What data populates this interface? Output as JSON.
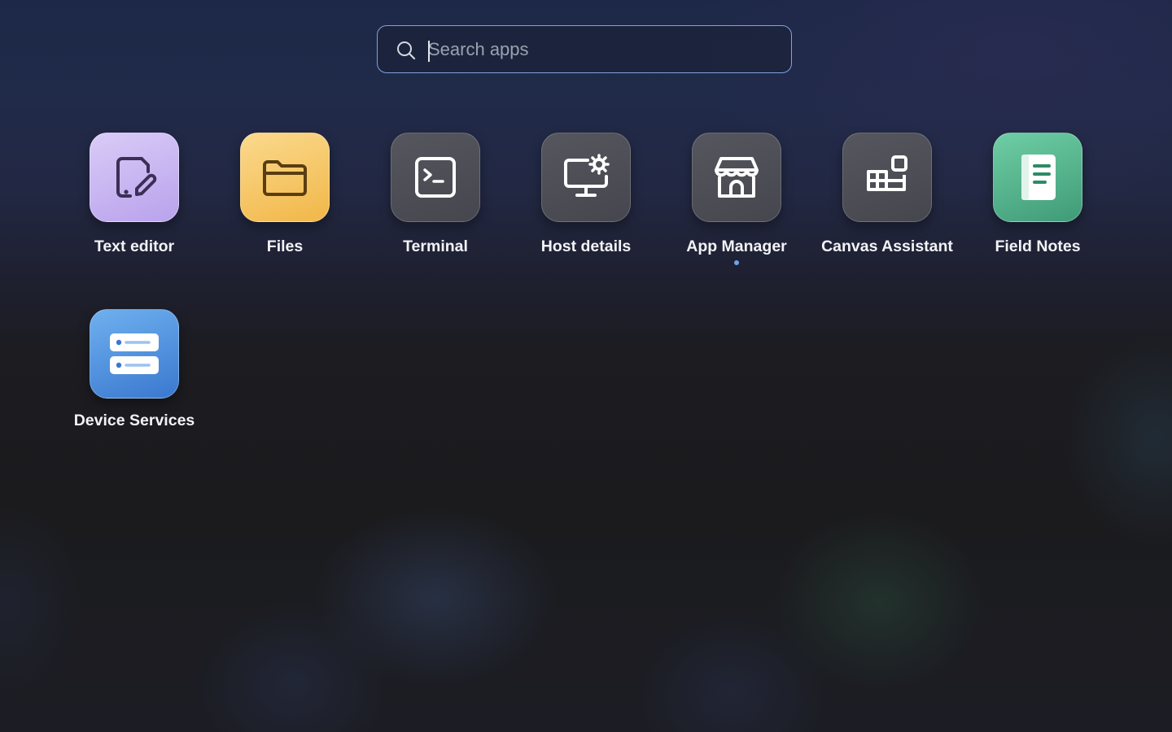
{
  "search": {
    "placeholder": "Search apps",
    "value": ""
  },
  "apps": [
    {
      "label": "Text editor",
      "icon": "text-editor-icon",
      "color": "#c6b3f2"
    },
    {
      "label": "Files",
      "icon": "folder-icon",
      "color": "#f6c866"
    },
    {
      "label": "Terminal",
      "icon": "terminal-icon",
      "color": "#4d4e56"
    },
    {
      "label": "Host details",
      "icon": "monitor-gear-icon",
      "color": "#4d4e56"
    },
    {
      "label": "App Manager",
      "icon": "store-icon",
      "color": "#4d4e56",
      "running": true
    },
    {
      "label": "Canvas Assistant",
      "icon": "widgets-icon",
      "color": "#4d4e56"
    },
    {
      "label": "Field Notes",
      "icon": "notebook-icon",
      "color": "#56b88e"
    },
    {
      "label": "Device Services",
      "icon": "server-icon",
      "color": "#4f93e0"
    }
  ],
  "colors": {
    "accent": "#7fa3dd",
    "running_indicator": "#6fa2ec"
  }
}
